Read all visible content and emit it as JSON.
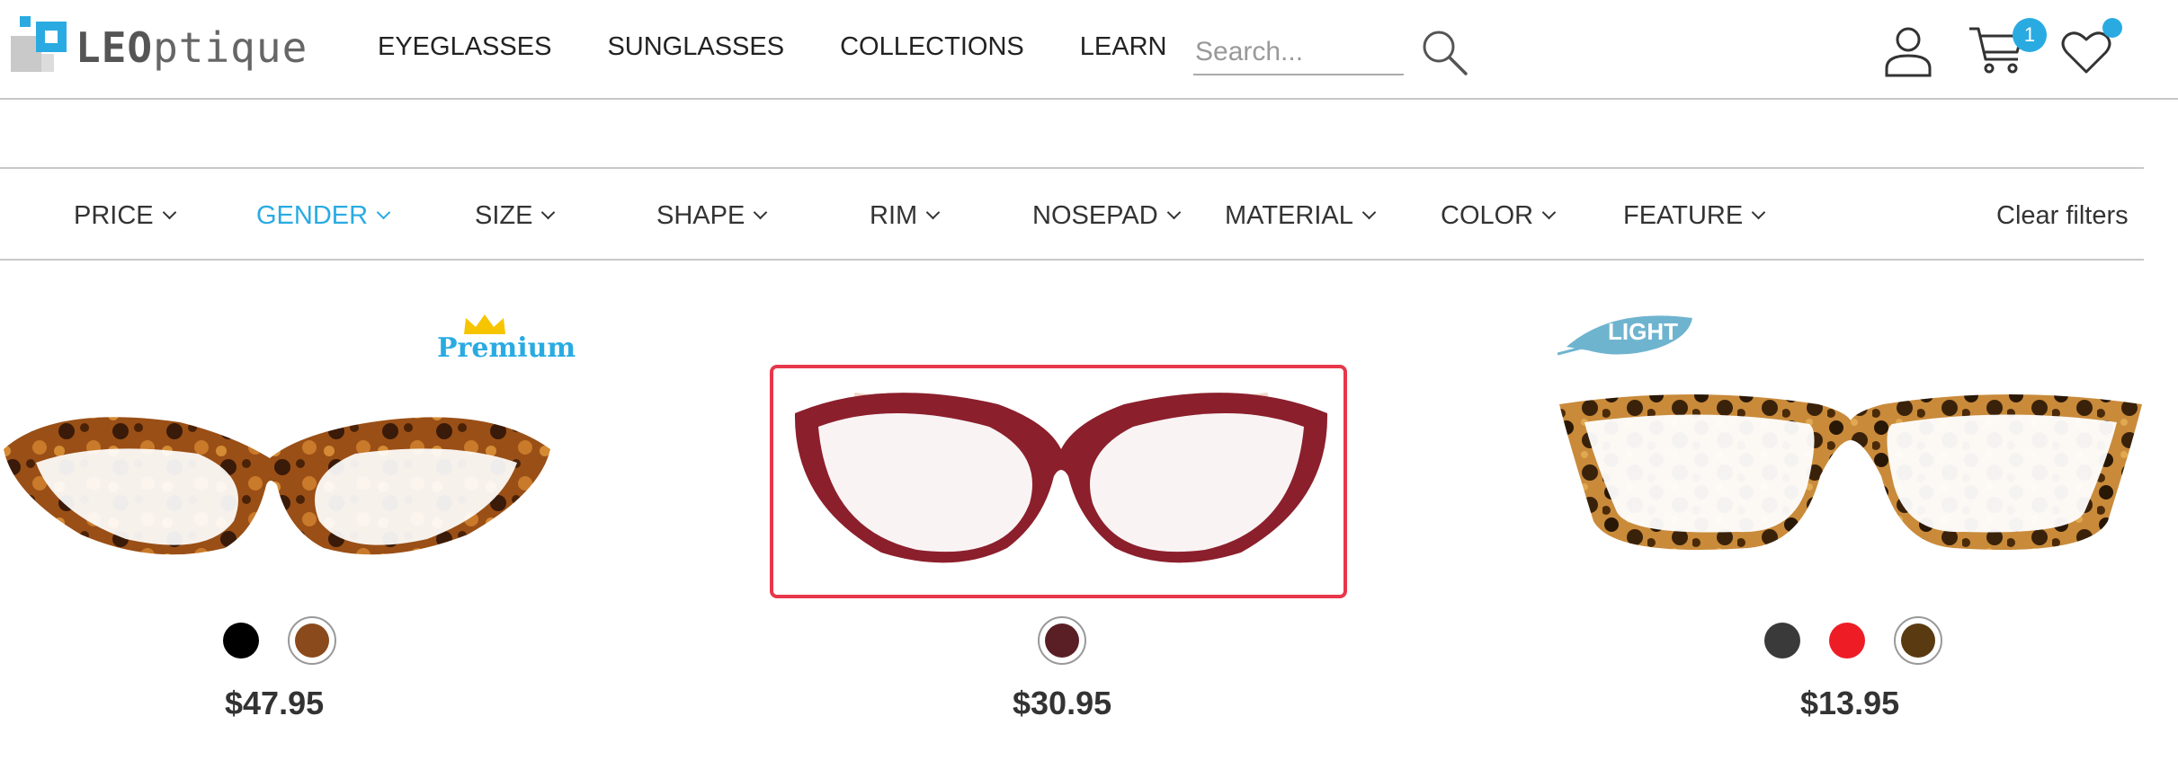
{
  "header": {
    "logo": {
      "bold": "LEO",
      "light": "ptique"
    },
    "nav": [
      "EYEGLASSES",
      "SUNGLASSES",
      "COLLECTIONS",
      "LEARN"
    ],
    "search_placeholder": "Search...",
    "cart_count": "1",
    "icons": {
      "search": "search-icon",
      "user": "user-icon",
      "cart": "cart-icon",
      "wishlist": "heart-icon"
    }
  },
  "filters": {
    "items": [
      "PRICE",
      "GENDER",
      "SIZE",
      "SHAPE",
      "RIM",
      "NOSEPAD",
      "MATERIAL",
      "COLOR",
      "FEATURE"
    ],
    "active": "GENDER",
    "clear_label": "Clear filters"
  },
  "colors": {
    "accent": "#29abe2",
    "highlight": "#e8374a"
  },
  "products": [
    {
      "tag": "Premium",
      "price": "$47.95",
      "frame": "tortoise cat-eye",
      "swatches": [
        "#000000",
        "#8a4a1c"
      ],
      "selected": 1
    },
    {
      "tag": "",
      "price": "$30.95",
      "frame": "burgundy cat-eye",
      "swatches": [
        "#5a1f24"
      ],
      "selected": 0
    },
    {
      "tag": "LIGHT",
      "price": "$13.95",
      "frame": "tortoise rectangle",
      "swatches": [
        "#3a3a3a",
        "#ee1c25",
        "#5a3a10"
      ],
      "selected": 2
    }
  ]
}
